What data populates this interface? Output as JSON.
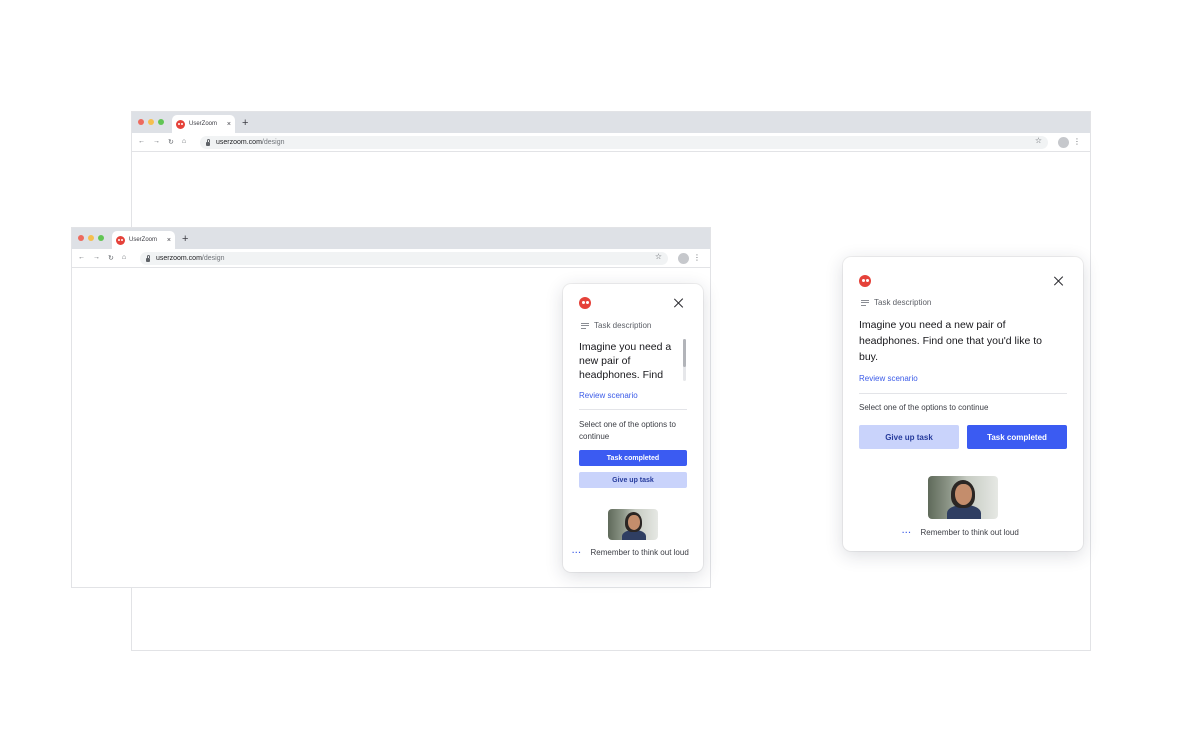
{
  "browser_back": {
    "tab_title": "UserZoom",
    "tab_close": "×",
    "new_tab": "+",
    "url_host": "userzoom.com",
    "url_path": "/design",
    "nav": [
      "←",
      "→",
      "↻",
      "⌂"
    ],
    "star": "☆",
    "menu": "⋮"
  },
  "browser_front": {
    "tab_title": "UserZoom",
    "tab_close": "×",
    "new_tab": "+",
    "url_host": "userzoom.com",
    "url_path": "/design",
    "nav": [
      "←",
      "→",
      "↻",
      "⌂"
    ],
    "star": "☆",
    "menu": "⋮"
  },
  "widget_small": {
    "task_description_label": "Task description",
    "task_text": "Imagine you need a new pair of headphones. Find",
    "review_link": "Review scenario",
    "select_prompt": "Select one of the options to continue",
    "task_completed_button": "Task completed",
    "give_up_button": "Give up task",
    "think_aloud": "Remember to think out loud",
    "dots": "···"
  },
  "widget_large": {
    "task_description_label": "Task description",
    "task_text": "Imagine you need a new pair of headphones. Find one that you'd like to buy.",
    "review_link": "Review scenario",
    "select_prompt": "Select one of the options to continue",
    "give_up_button": "Give up task",
    "task_completed_button": "Task completed",
    "think_aloud": "Remember to think out loud",
    "dots": "···"
  },
  "colors": {
    "brand_logo": "#e5423a",
    "primary_button": "#3b5bf2",
    "secondary_button": "#c9d3fb",
    "link": "#3b5be8"
  },
  "icons": [
    "userzoom-logo-icon",
    "close-icon",
    "task-description-icon",
    "think-aloud-dots-icon",
    "lock-icon",
    "star-icon",
    "menu-icon"
  ]
}
